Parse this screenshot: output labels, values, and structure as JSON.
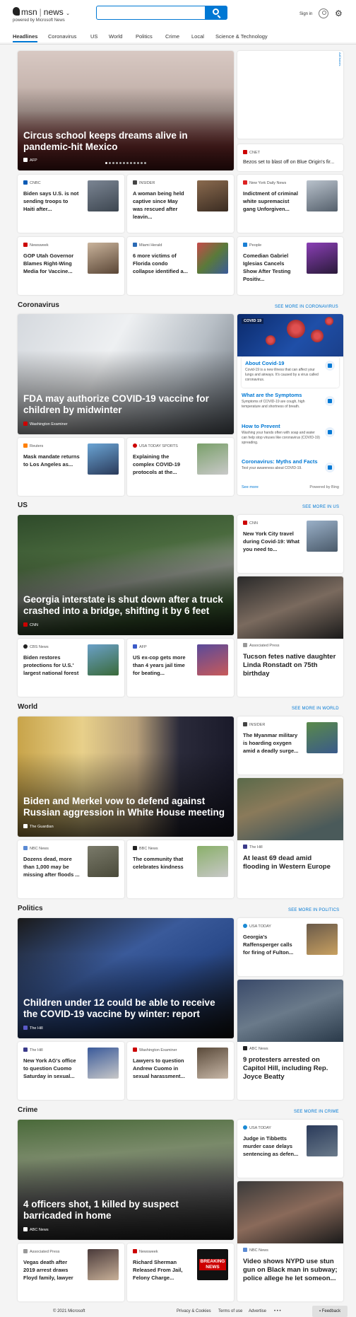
{
  "header": {
    "brand": "msn",
    "product": "news",
    "powered_by": "powered by Microsoft News",
    "search_value": "",
    "sign_in": "Sign in"
  },
  "nav": [
    "Headlines",
    "Coronavirus",
    "US",
    "World",
    "Politics",
    "Crime",
    "Local",
    "Science & Technology"
  ],
  "top": {
    "hero": {
      "title": "Circus school keeps dreams alive in pandemic-hit Mexico",
      "source": "AFP"
    },
    "ad": {
      "label": "AdChoices"
    },
    "cnet": {
      "source": "CNET",
      "title": "Bezos set to blast off on Blue Origin's fir..."
    },
    "row1": [
      {
        "source": "CNBC",
        "title": "Biden says U.S. is not sending troops to Haiti after..."
      },
      {
        "source": "INSIDER",
        "title": "A woman being held captive since May was rescued after leavin..."
      },
      {
        "source": "New York Daily News",
        "title": "Indictment of criminal white supremacist gang Unforgiven..."
      }
    ],
    "row2": [
      {
        "source": "Newsweek",
        "title": "GOP Utah Governor Blames Right-Wing Media for Vaccine..."
      },
      {
        "source": "Miami Herald",
        "title": "6 more victims of Florida condo collapse identified a..."
      },
      {
        "source": "People",
        "title": "Comedian Gabriel Iglesias Cancels Show After Testing Positiv..."
      }
    ]
  },
  "coronavirus": {
    "heading": "Coronavirus",
    "see_more": "SEE MORE IN CORONAVIRUS",
    "hero": {
      "title": "FDA may authorize COVID-19 vaccine for children by midwinter",
      "source": "Washington Examiner"
    },
    "row": [
      {
        "source": "Reuters",
        "title": "Mask mandate returns to Los Angeles as..."
      },
      {
        "source": "USA TODAY SPORTS",
        "title": "Explaining the complex COVID-19 protocols at the..."
      }
    ],
    "panel": {
      "label": "COVID 19",
      "items": [
        {
          "title": "About Covid-19",
          "desc": "Covid-19 is a new illness that can affect your lungs and airways. It's caused by a virus called coronavirus."
        },
        {
          "title": "What are the Symptoms",
          "desc": "Symptoms of COVID-19 are cough, high temperature and shortness of breath."
        },
        {
          "title": "How to Prevent",
          "desc": "Washing your hands often with soap and water can help stop viruses like coronavirus (COVID-19) spreading."
        },
        {
          "title": "Coronavirus: Myths and Facts",
          "desc": "Test your awareness about COVID-19."
        }
      ],
      "see_more": "See more",
      "powered": "Powered by Bing"
    }
  },
  "us": {
    "heading": "US",
    "see_more": "SEE MORE IN US",
    "hero": {
      "title": "Georgia interstate is shut down after a truck crashed into a bridge, shifting it by 6 feet",
      "source": "CNN"
    },
    "side_top": {
      "source": "CNN",
      "title": "New York City travel during Covid-19: What you need to..."
    },
    "row": [
      {
        "source": "CBS News",
        "title": "Biden restores protections for U.S.' largest national forest"
      },
      {
        "source": "AFP",
        "title": "US ex-cop gets more than 4 years jail time for beating..."
      }
    ],
    "pic": {
      "source": "Associated Press",
      "title": "Tucson fetes native daughter Linda Ronstadt on 75th birthday"
    }
  },
  "world": {
    "heading": "World",
    "see_more": "SEE MORE IN WORLD",
    "hero": {
      "title": "Biden and Merkel vow to defend against Russian aggression in White House meeting",
      "source": "The Guardian"
    },
    "side_top": {
      "source": "INSIDER",
      "title": "The Myanmar military is hoarding oxygen amid a deadly surge..."
    },
    "row": [
      {
        "source": "NBC News",
        "title": "Dozens dead, more than 1,000 may be missing after floods ..."
      },
      {
        "source": "BBC News",
        "title": "The community that celebrates kindness"
      }
    ],
    "pic": {
      "source": "The Hill",
      "title": "At least 69 dead amid flooding in Western Europe"
    }
  },
  "politics": {
    "heading": "Politics",
    "see_more": "SEE MORE IN POLITICS",
    "hero": {
      "title": "Children under 12 could be able to receive the COVID-19 vaccine by winter: report",
      "source": "The Hill"
    },
    "side_top": {
      "source": "USA TODAY",
      "title": "Georgia's Raffensperger calls for firing of Fulton..."
    },
    "row": [
      {
        "source": "The Hill",
        "title": "New York AG's office to question Cuomo Saturday in sexual..."
      },
      {
        "source": "Washington Examiner",
        "title": "Lawyers to question Andrew Cuomo in sexual harassment..."
      }
    ],
    "pic": {
      "source": "ABC News",
      "title": "9 protesters arrested on Capitol Hill, including Rep. Joyce Beatty"
    }
  },
  "crime": {
    "heading": "Crime",
    "see_more": "SEE MORE IN CRIME",
    "hero": {
      "title": "4 officers shot, 1 killed by suspect barricaded in home",
      "source": "ABC News"
    },
    "side_top": {
      "source": "USA TODAY",
      "title": "Judge in Tibbetts murder case delays sentencing as defen..."
    },
    "row": [
      {
        "source": "Associated Press",
        "title": "Vegas death after 2019 arrest draws Floyd family, lawyer"
      },
      {
        "source": "Newsweek",
        "title": "Richard Sherman Released From Jail, Felony Charge..."
      }
    ],
    "pic": {
      "source": "NBC News",
      "title": "Video shows NYPD use stun gun on Black man in subway; police allege he let someon..."
    },
    "breaking_text": "BREAKING NEWS"
  },
  "footer": {
    "copyright": "© 2021 Microsoft",
    "privacy": "Privacy & Cookies",
    "terms": "Terms of use",
    "advertise": "Advertise",
    "more": "• • •",
    "feedback": "Feedback"
  },
  "colors": {
    "accent": "#0078d4",
    "page_bg": "#f4f4f4"
  }
}
